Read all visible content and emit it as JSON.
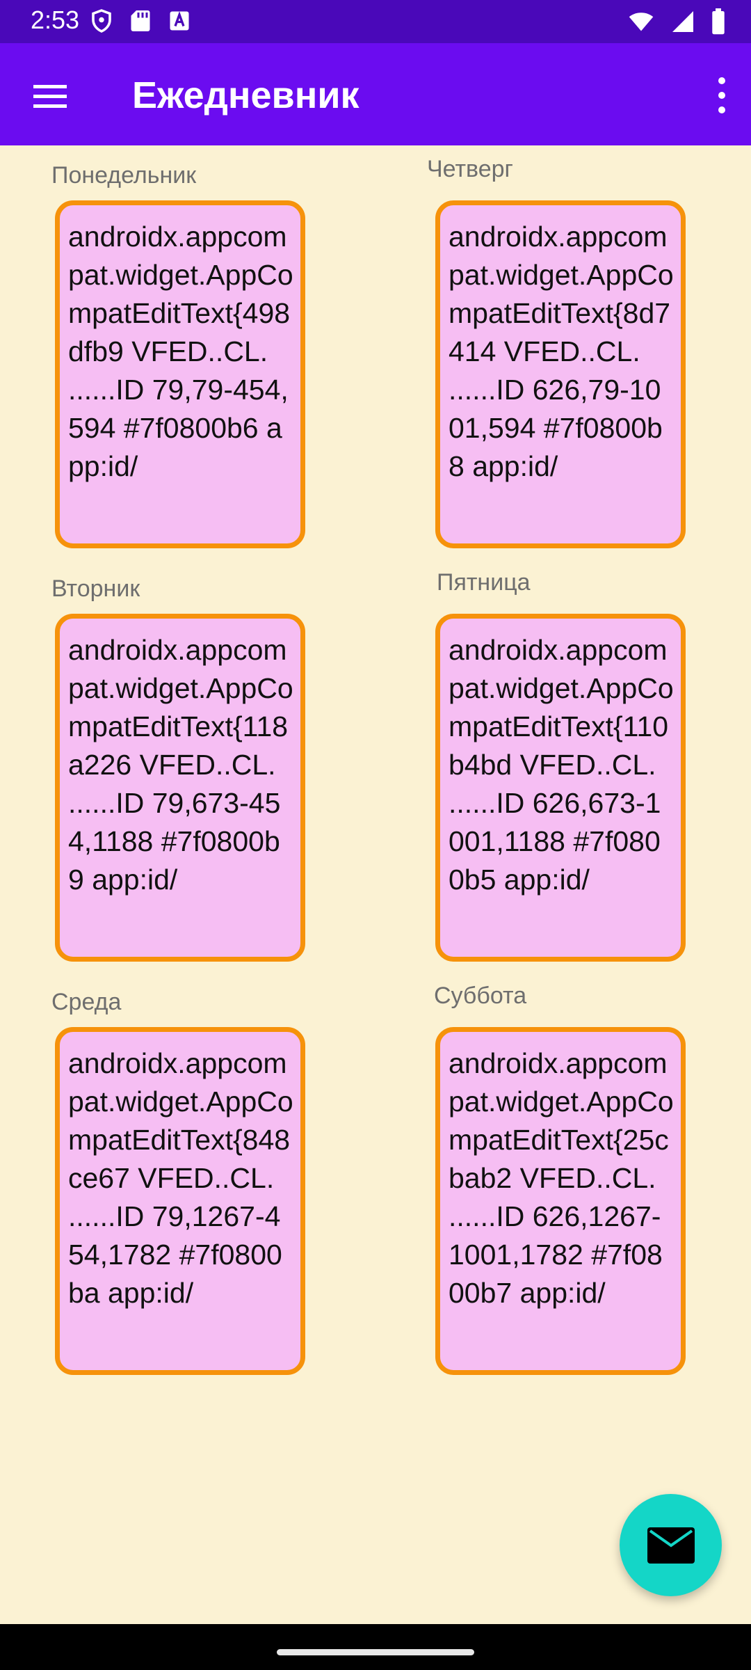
{
  "status_bar": {
    "time": "2:53",
    "icons_left": [
      "shield-icon",
      "sd-card-icon",
      "font-download-icon"
    ],
    "icons_right": [
      "wifi-icon",
      "cellular-signal-icon",
      "battery-icon"
    ]
  },
  "app_bar": {
    "title": "Ежедневник",
    "menu_icon": "hamburger-menu-icon",
    "overflow_icon": "more-vertical-icon",
    "color": "#6B0CF0"
  },
  "days": {
    "monday": {
      "label": "Понедельник",
      "note": "androidx.appcompat.widget.AppCompatEditText{498dfb9 VFED..CL. ......ID 79,79-454,594 #7f0800b6 app:id/"
    },
    "thursday": {
      "label": "Четверг",
      "note": "androidx.appcompat.widget.AppCompatEditText{8d7414 VFED..CL. ......ID 626,79-1001,594 #7f0800b8 app:id/"
    },
    "tuesday": {
      "label": "Вторник",
      "note": "androidx.appcompat.widget.AppCompatEditText{118a226 VFED..CL. ......ID 79,673-454,1188 #7f0800b9 app:id/"
    },
    "friday": {
      "label": "Пятница",
      "note": "androidx.appcompat.widget.AppCompatEditText{110b4bd VFED..CL. ......ID 626,673-1001,1188 #7f0800b5 app:id/"
    },
    "wednesday": {
      "label": "Среда",
      "note": "androidx.appcompat.widget.AppCompatEditText{848ce67 VFED..CL. ......ID 79,1267-454,1782 #7f0800ba app:id/"
    },
    "saturday": {
      "label": "Суббота",
      "note": "androidx.appcompat.widget.AppCompatEditText{25cbab2 VFED..CL. ......ID 626,1267-1001,1782 #7f0800b7 app:id/"
    }
  },
  "fab": {
    "icon": "email-icon",
    "color": "#14D6C7"
  },
  "colors": {
    "background": "#FBF2D3",
    "note_fill": "#F6BEF3",
    "note_border": "#F6920B",
    "status_bar": "#4A08B9"
  }
}
